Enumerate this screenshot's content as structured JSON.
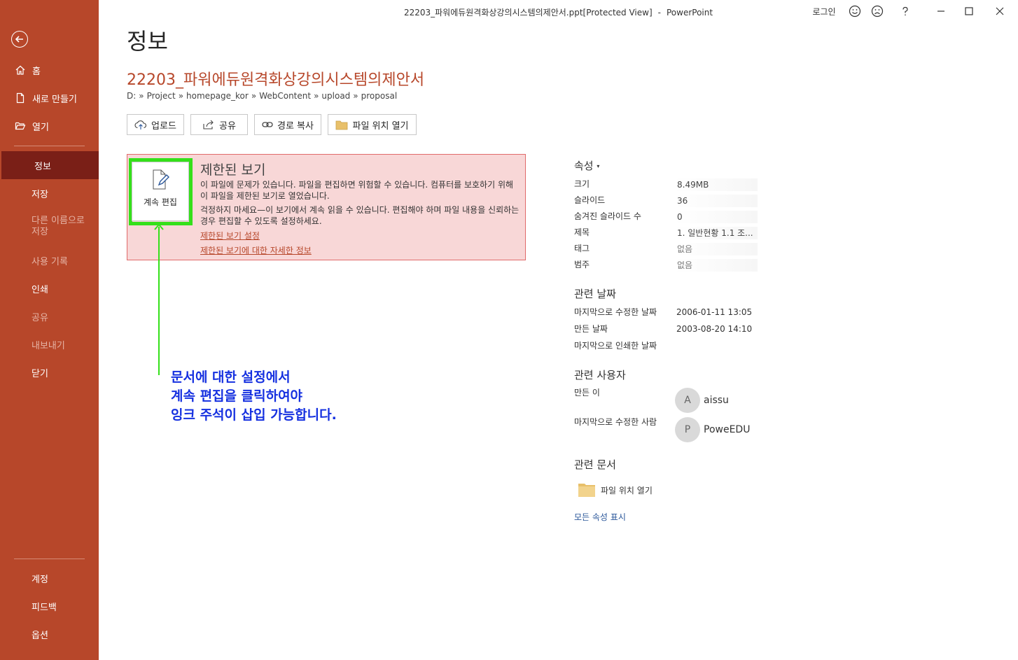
{
  "window": {
    "title": "22203_파워에듀원격화상강의시스템의제안서.ppt[Protected View]",
    "separator": "-",
    "app_name": "PowerPoint",
    "signin_label": "로그인"
  },
  "sidebar": {
    "top_items": [
      {
        "label": "홈",
        "icon": "home-icon"
      },
      {
        "label": "새로 만들기",
        "icon": "new-file-icon"
      },
      {
        "label": "열기",
        "icon": "open-folder-icon"
      }
    ],
    "items": [
      {
        "label": "정보",
        "state": "active"
      },
      {
        "label": "저장",
        "state": "enabled"
      },
      {
        "label": "다른 이름으로",
        "state": "disabled"
      },
      {
        "label": "저장",
        "state": "disabled"
      },
      {
        "label": "사용 기록",
        "state": "disabled"
      },
      {
        "label": "인쇄",
        "state": "enabled"
      },
      {
        "label": "공유",
        "state": "disabled"
      },
      {
        "label": "내보내기",
        "state": "disabled"
      },
      {
        "label": "닫기",
        "state": "enabled"
      }
    ],
    "bottom_items": [
      {
        "label": "계정"
      },
      {
        "label": "피드백"
      },
      {
        "label": "옵션"
      }
    ]
  },
  "main": {
    "page_title": "정보",
    "doc_title": "22203_파워에듀원격화상강의시스템의제안서",
    "breadcrumb": [
      "D:",
      "Project",
      "homepage_kor",
      "WebContent",
      "upload",
      "proposal"
    ],
    "breadcrumb_sep": "»",
    "actions": [
      {
        "label": "업로드",
        "icon": "upload-icon"
      },
      {
        "label": "공유",
        "icon": "share-icon"
      },
      {
        "label": "경로 복사",
        "icon": "link-icon"
      },
      {
        "label": "파일 위치 열기",
        "icon": "folder-icon"
      }
    ]
  },
  "protected_view": {
    "title": "제한된 보기",
    "button_label": "계속 편집",
    "text1": "이 파일에 문제가 있습니다. 파일을 편집하면 위험할 수 있습니다. 컴퓨터를 보호하기 위해 이 파일을 제한된 보기로 열었습니다.",
    "text2": "걱정하지 마세요—이 보기에서 계속 읽을 수 있습니다. 편집해야 하며 파일 내용을 신뢰하는 경우 편집할 수 있도록 설정하세요.",
    "link1": "제한된 보기 설정",
    "link2": "제한된 보기에 대한 자세한 정보"
  },
  "annotation": {
    "line1": "문서에 대한 설정에서",
    "line2": "계속 편집을 클릭하여야",
    "line3": "잉크 주석이 삽입 가능합니다.",
    "color": "#1530e0",
    "highlight_color": "#34e01a"
  },
  "properties": {
    "header": "속성",
    "rows": [
      {
        "label": "크기",
        "value": "8.49MB"
      },
      {
        "label": "슬라이드",
        "value": "36"
      },
      {
        "label": "숨겨진 슬라이드 수",
        "value": "0"
      },
      {
        "label": "제목",
        "value": "1. 일반현황 1.1 조..."
      },
      {
        "label": "태그",
        "value": "없음"
      },
      {
        "label": "범주",
        "value": "없음"
      }
    ]
  },
  "dates": {
    "header": "관련 날짜",
    "rows": [
      {
        "label": "마지막으로 수정한 날짜",
        "value": "2006-01-11 13:05"
      },
      {
        "label": "만든 날짜",
        "value": "2003-08-20 14:10"
      },
      {
        "label": "마지막으로 인쇄한 날짜",
        "value": ""
      }
    ]
  },
  "people": {
    "header": "관련 사용자",
    "author_label": "만든 이",
    "author_initial": "A",
    "author_name": "aissu",
    "modifier_label": "마지막으로 수정한 사람",
    "modifier_initial": "P",
    "modifier_name": "PoweEDU"
  },
  "related_docs": {
    "header": "관련 문서",
    "open_location": "파일 위치 열기",
    "show_all": "모든 속성 표시"
  },
  "colors": {
    "sidebar": "#b7472a",
    "sidebar_active": "#7a1f17",
    "warning_bg": "#f8d7d7",
    "warning_border": "#e06a6a",
    "link": "#2b579a"
  }
}
